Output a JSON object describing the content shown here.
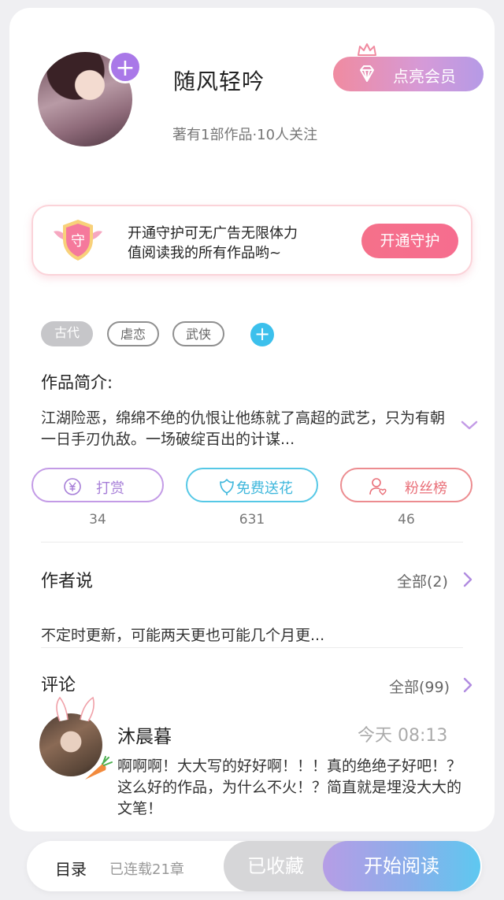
{
  "author": {
    "name": "随风轻吟",
    "meta": "著有1部作品·10人关注",
    "vip_label": "点亮会员",
    "plus": "+"
  },
  "guard": {
    "badge_char": "守",
    "text_line1": "开通守护可无广告无限体力",
    "text_line2": "值阅读我的所有作品哟~",
    "button": "开通守护"
  },
  "tags": {
    "items": [
      "古代",
      "虐恋",
      "武侠"
    ],
    "add": "+"
  },
  "intro": {
    "title": "作品简介:",
    "text": "江湖险恶，绵绵不绝的仇恨让他练就了高超的武艺，只为有朝一日手刃仇敌。一场破绽百出的计谋..."
  },
  "actions": [
    {
      "label": "打赏",
      "count": "34",
      "icon": "coin-icon"
    },
    {
      "label": "免费送花",
      "count": "631",
      "icon": "flower-icon"
    },
    {
      "label": "粉丝榜",
      "count": "46",
      "icon": "fan-icon"
    }
  ],
  "author_says": {
    "title": "作者说",
    "all": "全部(2)",
    "text": "不定时更新，可能两天更也可能几个月更..."
  },
  "comments": {
    "title": "评论",
    "all": "全部(99)",
    "items": [
      {
        "name": "沐晨暮",
        "time": "今天 08:13",
        "text": "啊啊啊！大大写的好好啊！！！真的绝绝子好吧！？这么好的作品，为什么不火！？简直就是埋没大大的文笔！"
      }
    ]
  },
  "bottom_bar": {
    "toc": "目录",
    "serial": "已连载21章",
    "collected": "已收藏",
    "read": "开始阅读"
  },
  "colors": {
    "accent_purple": "#a978e8",
    "accent_pink": "#f5708a",
    "accent_blue": "#3eb7dc"
  }
}
